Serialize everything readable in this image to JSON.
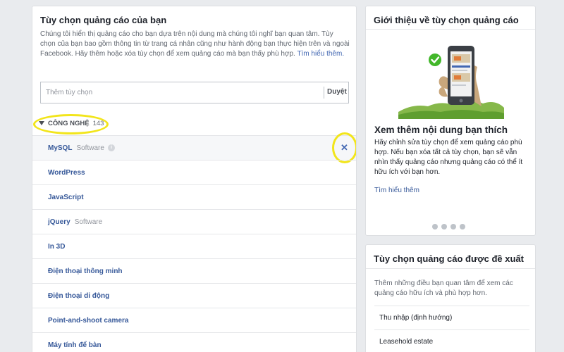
{
  "left_panel": {
    "title": "Tùy chọn quảng cáo của bạn",
    "description": "Chúng tôi hiển thị quảng cáo cho bạn dựa trên nội dung mà chúng tôi nghĩ bạn quan tâm. Tùy chọn của bạn bao gồm thông tin từ trang cá nhân cũng như hành động bạn thực hiện trên và ngoài Facebook. Hãy thêm hoặc xóa tùy chọn để xem quảng cáo mà bạn thấy phù hợp.",
    "learn_more": "Tìm hiểu thêm.",
    "search_placeholder": "Thêm tùy chọn",
    "browse_label": "Duyệt",
    "category": {
      "name": "CÔNG NGHỆ",
      "count": "143"
    },
    "items": [
      {
        "name": "MySQL",
        "sub": "Software",
        "info": "i",
        "remove": "✕"
      },
      {
        "name": "WordPress",
        "sub": ""
      },
      {
        "name": "JavaScript",
        "sub": ""
      },
      {
        "name": "jQuery",
        "sub": "Software"
      },
      {
        "name": "In 3D",
        "sub": ""
      },
      {
        "name": "Điện thoại thông minh",
        "sub": ""
      },
      {
        "name": "Điện thoại di động",
        "sub": ""
      },
      {
        "name": "Point-and-shoot camera",
        "sub": ""
      },
      {
        "name": "Máy tính để bàn",
        "sub": ""
      }
    ]
  },
  "intro_panel": {
    "title": "Giới thiệu về tùy chọn quảng cáo",
    "heading": "Xem thêm nội dung bạn thích",
    "body": "Hãy chỉnh sửa tùy chọn để xem quảng cáo phù hợp. Nếu bạn xóa tất cả tùy chọn, bạn sẽ vẫn nhìn thấy quảng cáo nhưng quảng cáo có thể ít hữu ích với bạn hơn.",
    "learn_more": "Tìm hiểu thêm"
  },
  "suggest_panel": {
    "title": "Tùy chọn quảng cáo được đề xuất",
    "description": "Thêm những điều bạn quan tâm để xem các quảng cáo hữu ích và phù hợp hơn.",
    "items": [
      "Thu nhập (định hướng)",
      "Leasehold estate"
    ]
  },
  "colors": {
    "link": "#365899",
    "highlight": "#f2e51b",
    "check_green": "#42b72a",
    "background": "#e9ebee"
  }
}
